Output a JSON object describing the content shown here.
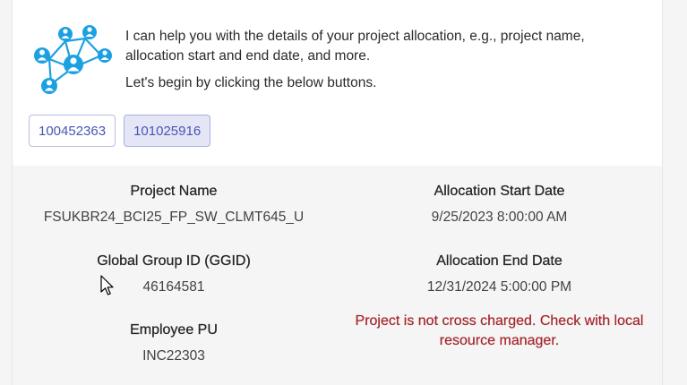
{
  "intro": {
    "line1": "I can help you with the details of your project allocation, e.g., project name, allocation start and end date, and more.",
    "line2": "Let's begin by clicking the below buttons."
  },
  "buttons": [
    {
      "label": "100452363",
      "selected": false
    },
    {
      "label": "101025916",
      "selected": true
    }
  ],
  "details": {
    "project_name": {
      "label": "Project Name",
      "value": "FSUKBR24_BCI25_FP_SW_CLMT645_U"
    },
    "allocation_start": {
      "label": "Allocation Start Date",
      "value": "9/25/2023 8:00:00 AM"
    },
    "ggid": {
      "label": "Global Group ID (GGID)",
      "value": "46164581"
    },
    "allocation_end": {
      "label": "Allocation End Date",
      "value": "12/31/2024 5:00:00 PM"
    },
    "employee_pu": {
      "label": "Employee PU",
      "value": "INC22303"
    },
    "warning": "Project is not cross charged. Check with local resource manager."
  },
  "colors": {
    "accent": "#4a55b5",
    "icon": "#1ba1e2",
    "warning": "#a4262c"
  }
}
